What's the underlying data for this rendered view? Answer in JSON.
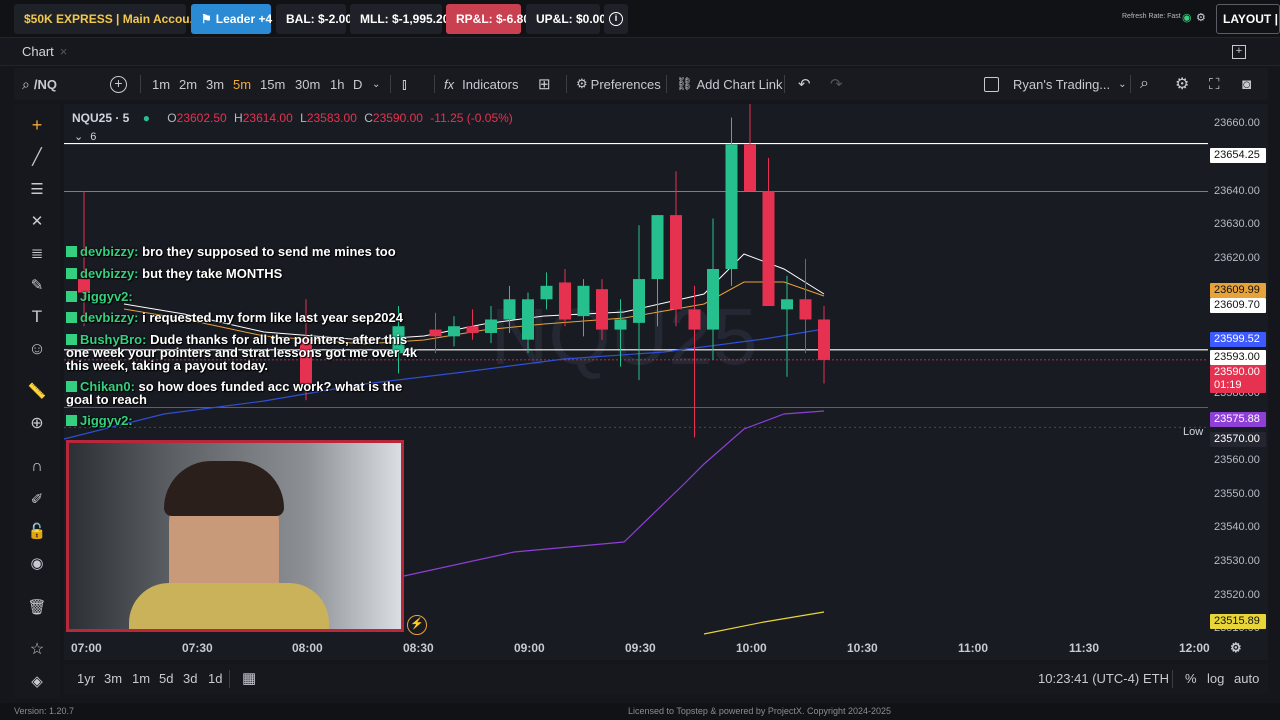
{
  "topbar": {
    "account_label": "$50K EXPRESS | Main Accou...",
    "leader_label": "Leader +4",
    "bal": "BAL: $-2.00",
    "mll": "MLL: $-1,995.20",
    "rpl": "RP&L: $-6.80",
    "upl": "UP&L: $0.00",
    "refresh_rate": "Refresh Rate: Fast",
    "layout_label": "LAYOUT | de"
  },
  "chart_tab": {
    "label": "Chart"
  },
  "toolbar": {
    "symbol": "/NQ",
    "intervals": [
      "1m",
      "2m",
      "3m",
      "5m",
      "15m",
      "30m",
      "1h",
      "D"
    ],
    "active_interval": "5m",
    "indicators": "Indicators",
    "preferences": "Preferences",
    "add_chart_link": "Add Chart Link",
    "layout_name": "Ryan's Trading..."
  },
  "legend": {
    "ticker": "NQU25 · 5",
    "o": "23602.50",
    "h": "23614.00",
    "l": "23583.00",
    "c": "23590.00",
    "change": "-11.25 (-0.05%)",
    "collapse_count": "6"
  },
  "watermark": "NQU25",
  "price_axis": {
    "ticks": [
      "23660.00",
      "23650.00",
      "23640.00",
      "23630.00",
      "23620.00",
      "23580.00",
      "23560.00",
      "23550.00",
      "23540.00",
      "23530.00",
      "23520.00",
      "23510.00"
    ],
    "labels": [
      {
        "text": "23654.25",
        "bg": "#ffffff",
        "fg": "#111111"
      },
      {
        "text": "23609.99",
        "bg": "#e8a23a",
        "fg": "#111111"
      },
      {
        "text": "23609.70",
        "bg": "#ffffff",
        "fg": "#111111"
      },
      {
        "text": "23599.52",
        "bg": "#3d5afe",
        "fg": "#ffffff"
      },
      {
        "text": "23593.00",
        "bg": "#ffffff",
        "fg": "#111111"
      },
      {
        "text": "23590.00",
        "bg": "#e63250",
        "fg": "#ffffff"
      },
      {
        "text": "01:19",
        "bg": "#e63250",
        "fg": "#ffffff"
      },
      {
        "text": "23575.88",
        "bg": "#8e3fd6",
        "fg": "#ffffff"
      },
      {
        "text": "23570.00",
        "bg": "#23262e",
        "fg": "#ffffff"
      },
      {
        "text": "23515.89",
        "bg": "#e8d53a",
        "fg": "#111111"
      }
    ],
    "low_label": "Low"
  },
  "time_axis": [
    "07:00",
    "07:30",
    "08:00",
    "08:30",
    "09:00",
    "09:30",
    "10:00",
    "10:30",
    "11:00",
    "11:30",
    "12:00"
  ],
  "bottom_bar": {
    "ranges": [
      "1yr",
      "3m",
      "1m",
      "5d",
      "3d",
      "1d"
    ],
    "clock": "10:23:41 (UTC-4)",
    "session": "ETH",
    "pct": "%",
    "log": "log",
    "auto": "auto"
  },
  "footer": {
    "version": "Version: 1.20.7",
    "license": "Licensed to Topstep & powered by ProjectX. Copyright 2024-2025"
  },
  "chat": [
    {
      "user": "devbizzy:",
      "msg": "bro they supposed to send me mines too"
    },
    {
      "user": "devbizzy:",
      "msg": "but they take MONTHS"
    },
    {
      "user": "Jiggyv2:",
      "msg": ""
    },
    {
      "user": "devbizzy:",
      "msg": "i requested my form like last year sep2024"
    },
    {
      "user": "BushyBro:",
      "msg": "Dude thanks for all the pointers, after this one week your pointers and strat lessons got me over 4k this week, taking a payout today."
    },
    {
      "user": "Chikan0:",
      "msg": "so how does funded acc work? what is the goal to reach"
    },
    {
      "user": "Jiggyv2:",
      "msg": ""
    }
  ],
  "colors": {
    "up": "#26c08e",
    "down": "#e63250",
    "bg": "#181b22",
    "accent": "#2a8ad4"
  },
  "chart_data": {
    "type": "candlestick",
    "symbol": "NQU25",
    "interval": "5m",
    "ylim": [
      23508,
      23666
    ],
    "candles": [
      {
        "t": "07:00",
        "o": 23614,
        "h": 23640,
        "l": 23600,
        "c": 23610
      },
      {
        "t": "08:00",
        "o": 23596,
        "h": 23608,
        "l": 23578,
        "c": 23583
      },
      {
        "t": "08:25",
        "o": 23592,
        "h": 23606,
        "l": 23586,
        "c": 23600
      },
      {
        "t": "08:35",
        "o": 23599,
        "h": 23604,
        "l": 23592,
        "c": 23597
      },
      {
        "t": "08:40",
        "o": 23597,
        "h": 23603,
        "l": 23594,
        "c": 23600
      },
      {
        "t": "08:45",
        "o": 23600,
        "h": 23605,
        "l": 23596,
        "c": 23598
      },
      {
        "t": "08:50",
        "o": 23598,
        "h": 23606,
        "l": 23595,
        "c": 23602
      },
      {
        "t": "08:55",
        "o": 23602,
        "h": 23612,
        "l": 23598,
        "c": 23608
      },
      {
        "t": "09:00",
        "o": 23596,
        "h": 23610,
        "l": 23592,
        "c": 23608
      },
      {
        "t": "09:05",
        "o": 23608,
        "h": 23616,
        "l": 23605,
        "c": 23612
      },
      {
        "t": "09:10",
        "o": 23613,
        "h": 23617,
        "l": 23600,
        "c": 23602
      },
      {
        "t": "09:15",
        "o": 23603,
        "h": 23614,
        "l": 23597,
        "c": 23612
      },
      {
        "t": "09:20",
        "o": 23611,
        "h": 23614,
        "l": 23596,
        "c": 23599
      },
      {
        "t": "09:25",
        "o": 23599,
        "h": 23608,
        "l": 23588,
        "c": 23602
      },
      {
        "t": "09:30",
        "o": 23601,
        "h": 23630,
        "l": 23584,
        "c": 23614
      },
      {
        "t": "09:35",
        "o": 23614,
        "h": 23633,
        "l": 23600,
        "c": 23633
      },
      {
        "t": "09:40",
        "o": 23633,
        "h": 23646,
        "l": 23600,
        "c": 23605
      },
      {
        "t": "09:45",
        "o": 23605,
        "h": 23612,
        "l": 23567,
        "c": 23599
      },
      {
        "t": "09:50",
        "o": 23599,
        "h": 23632,
        "l": 23590,
        "c": 23617
      },
      {
        "t": "09:55",
        "o": 23617,
        "h": 23662,
        "l": 23612,
        "c": 23654
      },
      {
        "t": "10:00",
        "o": 23654,
        "h": 23668,
        "l": 23640,
        "c": 23640
      },
      {
        "t": "10:05",
        "o": 23640,
        "h": 23650,
        "l": 23606,
        "c": 23606
      },
      {
        "t": "10:10",
        "o": 23605,
        "h": 23615,
        "l": 23585,
        "c": 23608
      },
      {
        "t": "10:15",
        "o": 23608,
        "h": 23620,
        "l": 23592,
        "c": 23602
      },
      {
        "t": "10:20",
        "o": 23602,
        "h": 23606,
        "l": 23583,
        "c": 23590
      }
    ],
    "horizontal_lines": [
      23654.25,
      23640,
      23593,
      23590,
      23575.88,
      23570
    ],
    "session_low": 23570.0,
    "last_price": 23590.0,
    "bar_countdown": "01:19"
  }
}
